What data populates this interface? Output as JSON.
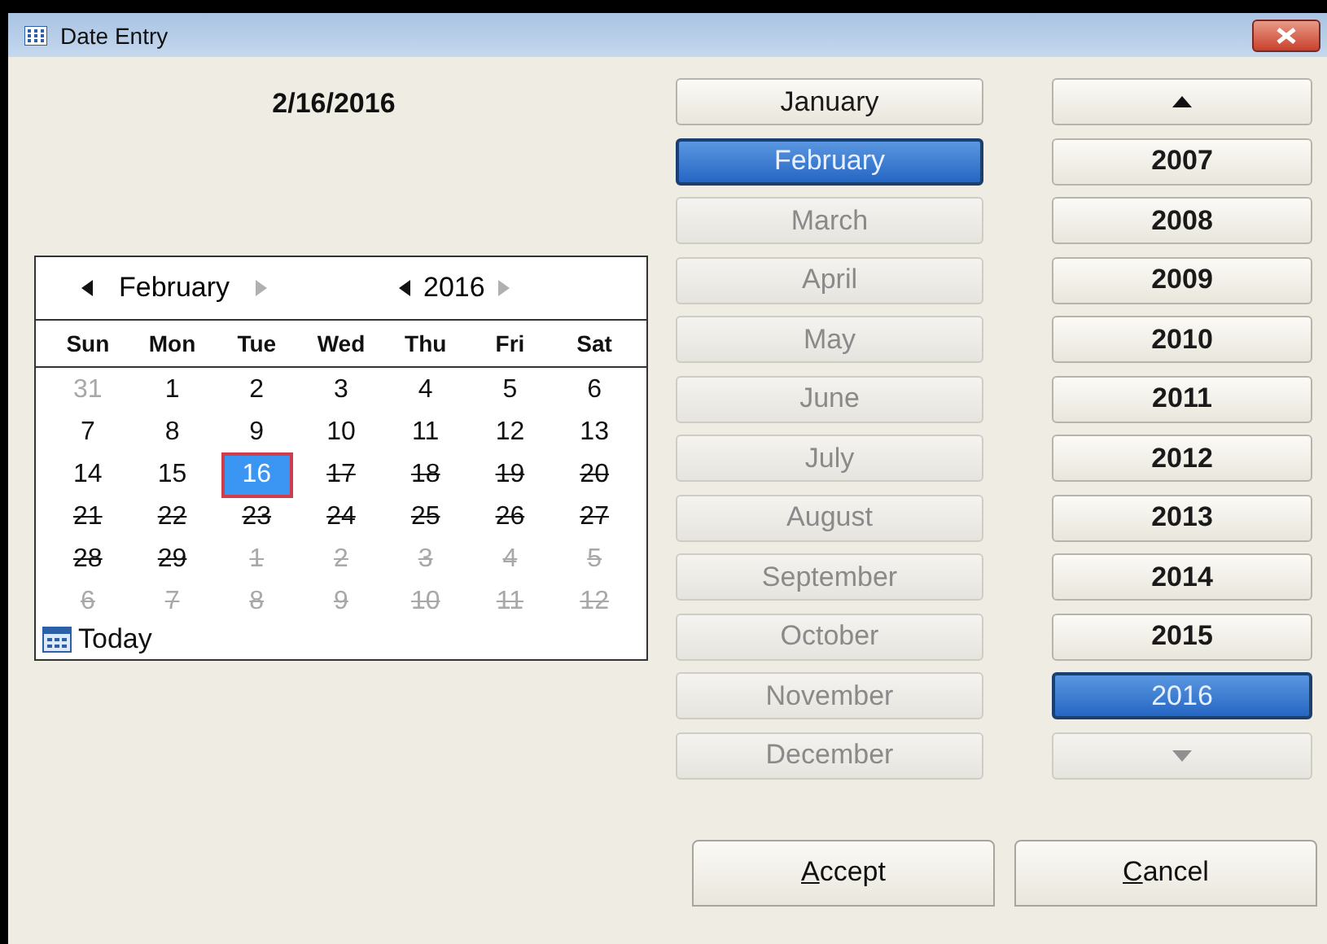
{
  "window": {
    "title": "Date Entry"
  },
  "date_display": "2/16/2016",
  "calendar": {
    "month_nav": {
      "label": "February",
      "prev_disabled": false,
      "next_disabled": true
    },
    "year_nav": {
      "label": "2016",
      "prev_disabled": false,
      "next_disabled": true
    },
    "weekdays": [
      "Sun",
      "Mon",
      "Tue",
      "Wed",
      "Thu",
      "Fri",
      "Sat"
    ],
    "weeks": [
      {
        "days": [
          {
            "day": "31",
            "other_month": true,
            "struck": false,
            "selected": false
          },
          {
            "day": "1",
            "other_month": false,
            "struck": false,
            "selected": false
          },
          {
            "day": "2",
            "other_month": false,
            "struck": false,
            "selected": false
          },
          {
            "day": "3",
            "other_month": false,
            "struck": false,
            "selected": false
          },
          {
            "day": "4",
            "other_month": false,
            "struck": false,
            "selected": false
          },
          {
            "day": "5",
            "other_month": false,
            "struck": false,
            "selected": false
          },
          {
            "day": "6",
            "other_month": false,
            "struck": false,
            "selected": false
          }
        ]
      },
      {
        "days": [
          {
            "day": "7",
            "other_month": false,
            "struck": false,
            "selected": false
          },
          {
            "day": "8",
            "other_month": false,
            "struck": false,
            "selected": false
          },
          {
            "day": "9",
            "other_month": false,
            "struck": false,
            "selected": false
          },
          {
            "day": "10",
            "other_month": false,
            "struck": false,
            "selected": false
          },
          {
            "day": "11",
            "other_month": false,
            "struck": false,
            "selected": false
          },
          {
            "day": "12",
            "other_month": false,
            "struck": false,
            "selected": false
          },
          {
            "day": "13",
            "other_month": false,
            "struck": false,
            "selected": false
          }
        ]
      },
      {
        "days": [
          {
            "day": "14",
            "other_month": false,
            "struck": false,
            "selected": false
          },
          {
            "day": "15",
            "other_month": false,
            "struck": false,
            "selected": false
          },
          {
            "day": "16",
            "other_month": false,
            "struck": false,
            "selected": true
          },
          {
            "day": "17",
            "other_month": false,
            "struck": true,
            "selected": false
          },
          {
            "day": "18",
            "other_month": false,
            "struck": true,
            "selected": false
          },
          {
            "day": "19",
            "other_month": false,
            "struck": true,
            "selected": false
          },
          {
            "day": "20",
            "other_month": false,
            "struck": true,
            "selected": false
          }
        ]
      },
      {
        "days": [
          {
            "day": "21",
            "other_month": false,
            "struck": true,
            "selected": false
          },
          {
            "day": "22",
            "other_month": false,
            "struck": true,
            "selected": false
          },
          {
            "day": "23",
            "other_month": false,
            "struck": true,
            "selected": false
          },
          {
            "day": "24",
            "other_month": false,
            "struck": true,
            "selected": false
          },
          {
            "day": "25",
            "other_month": false,
            "struck": true,
            "selected": false
          },
          {
            "day": "26",
            "other_month": false,
            "struck": true,
            "selected": false
          },
          {
            "day": "27",
            "other_month": false,
            "struck": true,
            "selected": false
          }
        ]
      },
      {
        "days": [
          {
            "day": "28",
            "other_month": false,
            "struck": true,
            "selected": false
          },
          {
            "day": "29",
            "other_month": false,
            "struck": true,
            "selected": false
          },
          {
            "day": "1",
            "other_month": true,
            "struck": true,
            "selected": false
          },
          {
            "day": "2",
            "other_month": true,
            "struck": true,
            "selected": false
          },
          {
            "day": "3",
            "other_month": true,
            "struck": true,
            "selected": false
          },
          {
            "day": "4",
            "other_month": true,
            "struck": true,
            "selected": false
          },
          {
            "day": "5",
            "other_month": true,
            "struck": true,
            "selected": false
          }
        ]
      },
      {
        "days": [
          {
            "day": "6",
            "other_month": true,
            "struck": true,
            "selected": false
          },
          {
            "day": "7",
            "other_month": true,
            "struck": true,
            "selected": false
          },
          {
            "day": "8",
            "other_month": true,
            "struck": true,
            "selected": false
          },
          {
            "day": "9",
            "other_month": true,
            "struck": true,
            "selected": false
          },
          {
            "day": "10",
            "other_month": true,
            "struck": true,
            "selected": false
          },
          {
            "day": "11",
            "other_month": true,
            "struck": true,
            "selected": false
          },
          {
            "day": "12",
            "other_month": true,
            "struck": true,
            "selected": false
          }
        ]
      }
    ],
    "today_link": "Today"
  },
  "months": [
    {
      "label": "January",
      "selected": false,
      "disabled": false
    },
    {
      "label": "February",
      "selected": true,
      "disabled": false
    },
    {
      "label": "March",
      "selected": false,
      "disabled": true
    },
    {
      "label": "April",
      "selected": false,
      "disabled": true
    },
    {
      "label": "May",
      "selected": false,
      "disabled": true
    },
    {
      "label": "June",
      "selected": false,
      "disabled": true
    },
    {
      "label": "July",
      "selected": false,
      "disabled": true
    },
    {
      "label": "August",
      "selected": false,
      "disabled": true
    },
    {
      "label": "September",
      "selected": false,
      "disabled": true
    },
    {
      "label": "October",
      "selected": false,
      "disabled": true
    },
    {
      "label": "November",
      "selected": false,
      "disabled": true
    },
    {
      "label": "December",
      "selected": false,
      "disabled": true
    }
  ],
  "years": [
    {
      "kind": "scroll_up",
      "selected": false,
      "disabled": false
    },
    {
      "kind": "year",
      "label": "2007",
      "selected": false,
      "disabled": false
    },
    {
      "kind": "year",
      "label": "2008",
      "selected": false,
      "disabled": false
    },
    {
      "kind": "year",
      "label": "2009",
      "selected": false,
      "disabled": false
    },
    {
      "kind": "year",
      "label": "2010",
      "selected": false,
      "disabled": false
    },
    {
      "kind": "year",
      "label": "2011",
      "selected": false,
      "disabled": false
    },
    {
      "kind": "year",
      "label": "2012",
      "selected": false,
      "disabled": false
    },
    {
      "kind": "year",
      "label": "2013",
      "selected": false,
      "disabled": false
    },
    {
      "kind": "year",
      "label": "2014",
      "selected": false,
      "disabled": false
    },
    {
      "kind": "year",
      "label": "2015",
      "selected": false,
      "disabled": false
    },
    {
      "kind": "year",
      "label": "2016",
      "selected": true,
      "disabled": false
    },
    {
      "kind": "scroll_down",
      "selected": false,
      "disabled": true
    }
  ],
  "buttons": [
    {
      "label": "Accept",
      "mnemonic_first": true
    },
    {
      "label": "Cancel",
      "mnemonic_first": true
    }
  ]
}
